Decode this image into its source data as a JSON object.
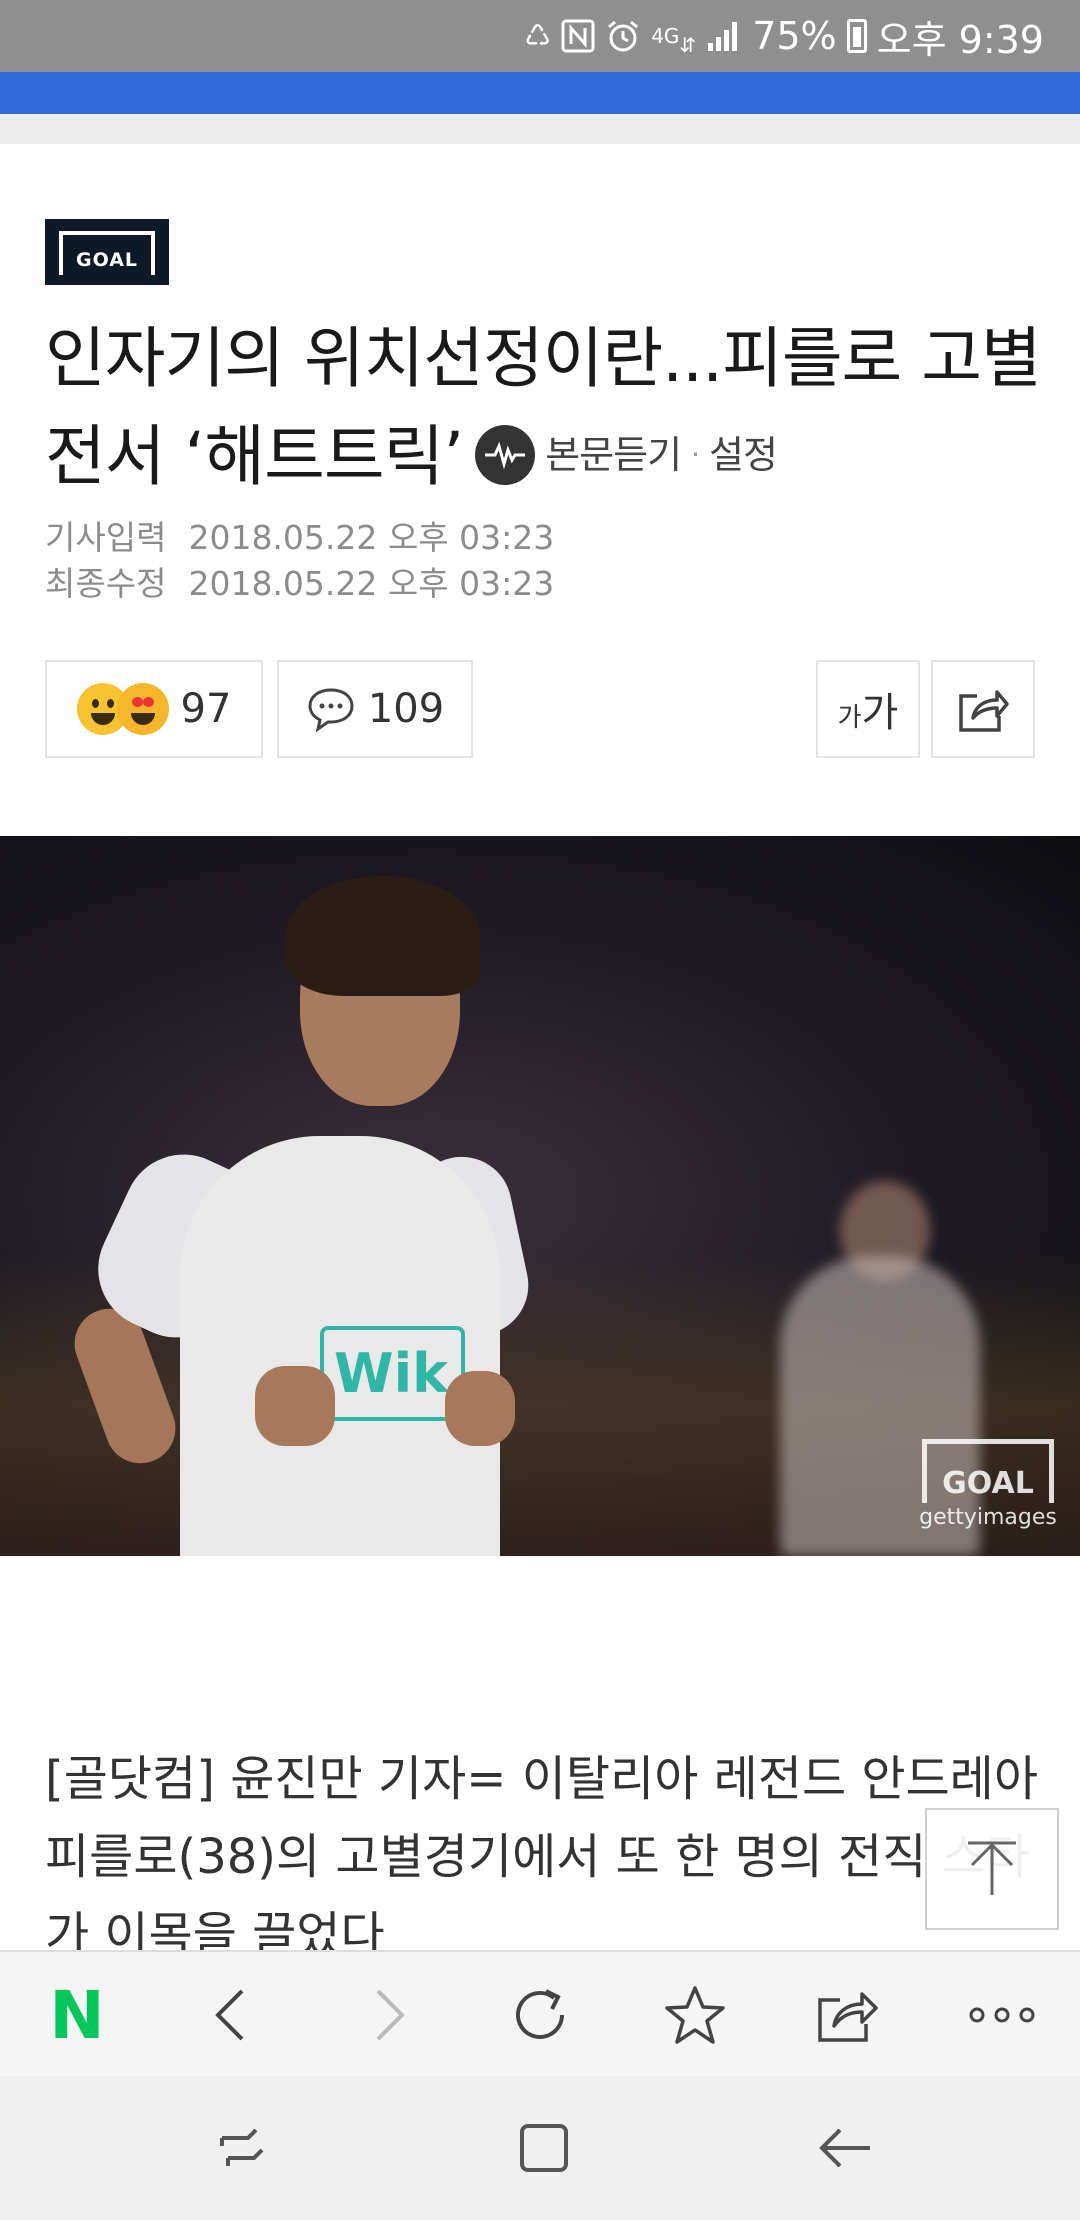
{
  "status_bar": {
    "network": "4G",
    "battery": "75%",
    "time": "오후 9:39",
    "icons": [
      "recycle-icon",
      "nfc-icon",
      "alarm-icon",
      "network-icon",
      "signal-icon",
      "battery-icon"
    ]
  },
  "article": {
    "source_logo": "GOAL",
    "title": "인자기의 위치선정이란...피를로 고별전서 ‘해트트릭’",
    "listen_label": "본문듣기",
    "settings_label": "설정",
    "published_label": "기사입력",
    "published_value": "2018.05.22 오후 03:23",
    "modified_label": "최종수정",
    "modified_value": "2018.05.22 오후 03:23",
    "reaction_count": "97",
    "comment_count": "109",
    "font_size_label_small": "가",
    "font_size_label_large": "가",
    "photo": {
      "sponsor_text": "Wik",
      "watermark_logo": "GOAL",
      "watermark_credit": "gettyimages"
    },
    "body": "[골닷컴] 윤진만 기자= 이탈리아 레전드 안드레아 피를로(38)의 고별경기에서 또 한 명의 전직 스타가 이목을 끌었다"
  },
  "colors": {
    "status_bar": "#8f8f8f",
    "top_bar": "#2f6bd4",
    "naver_green": "#03c75a"
  },
  "browser_toolbar": {
    "logo": "N",
    "items": [
      "naver-home",
      "back",
      "forward",
      "reload",
      "bookmark",
      "share",
      "more"
    ]
  },
  "system_nav": [
    "recent-apps",
    "home",
    "back"
  ]
}
